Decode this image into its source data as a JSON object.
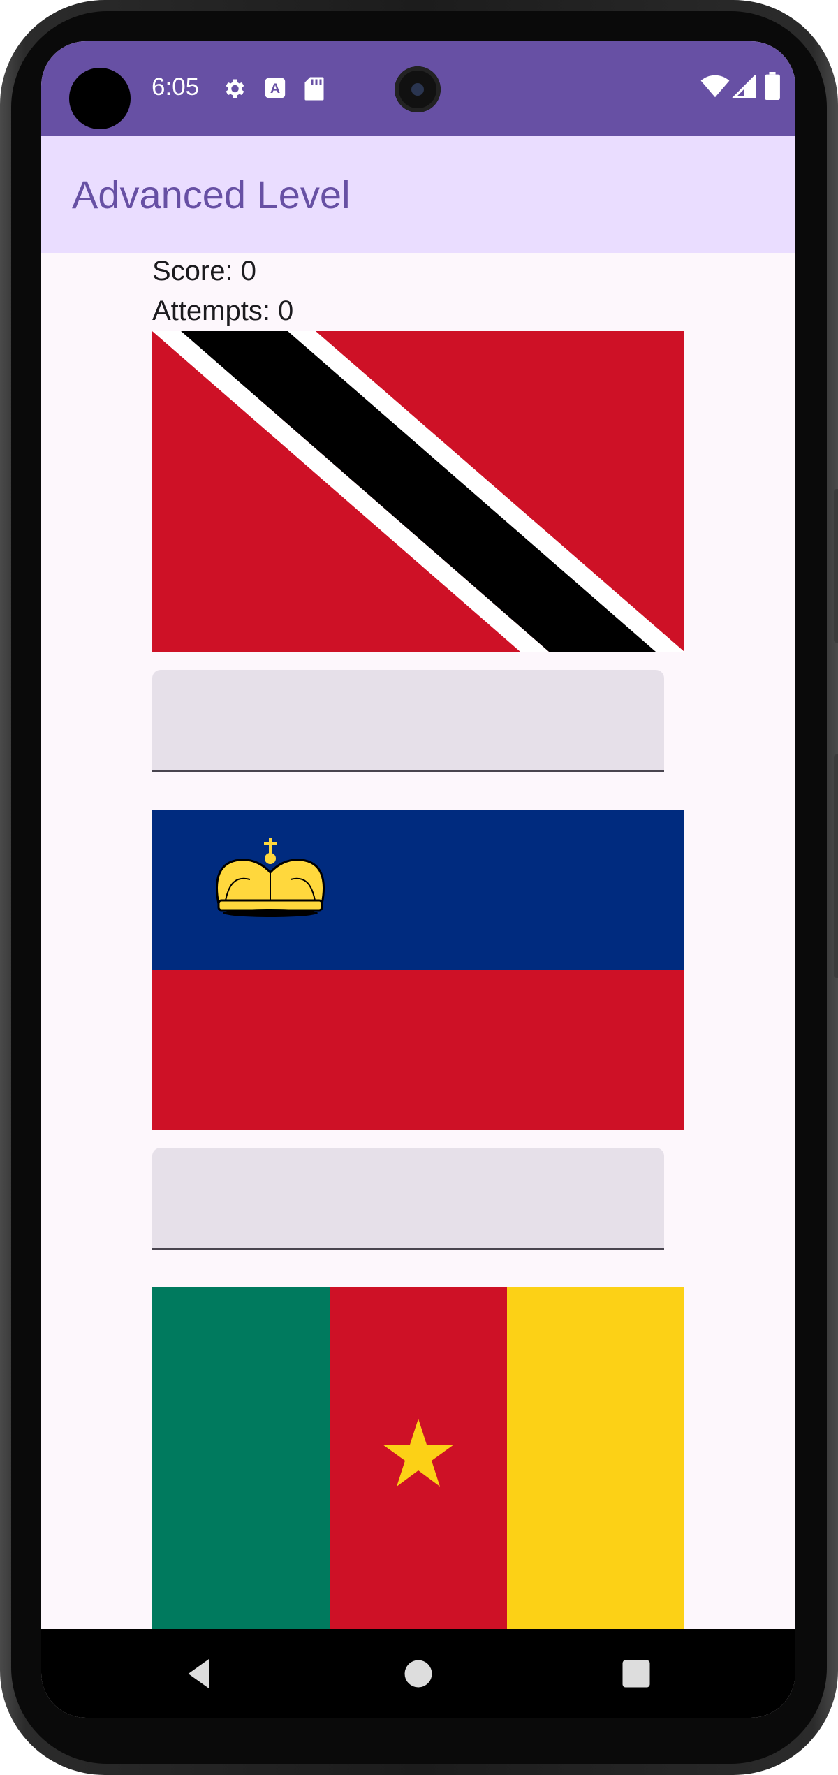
{
  "status_bar": {
    "time": "6:05",
    "left_icons": [
      "settings-icon",
      "autofill-a-icon",
      "sd-card-icon"
    ],
    "right_icons": [
      "wifi-icon",
      "cell-signal-icon",
      "battery-icon"
    ]
  },
  "app_bar": {
    "title": "Advanced Level"
  },
  "quiz": {
    "score_text": "Score: 0",
    "attempts_text": "Attempts: 0",
    "questions": [
      {
        "flag": "trinidad-and-tobago-flag",
        "answer_value": ""
      },
      {
        "flag": "liechtenstein-flag",
        "answer_value": ""
      },
      {
        "flag": "cameroon-flag",
        "answer_value": ""
      }
    ]
  },
  "colors": {
    "primary": "#6750a4",
    "app_bar_bg": "#eaddff",
    "screen_bg": "#fdf7fc",
    "field_bg": "#e6e0e9",
    "flag_red": "#ce1126",
    "flag_blue": "#002b7f",
    "flag_gold": "#ffd83d",
    "flag_green": "#007a5e",
    "flag_yellow": "#fcd116"
  },
  "nav_bar": {
    "buttons": [
      "back-icon",
      "home-icon",
      "recents-icon"
    ]
  }
}
